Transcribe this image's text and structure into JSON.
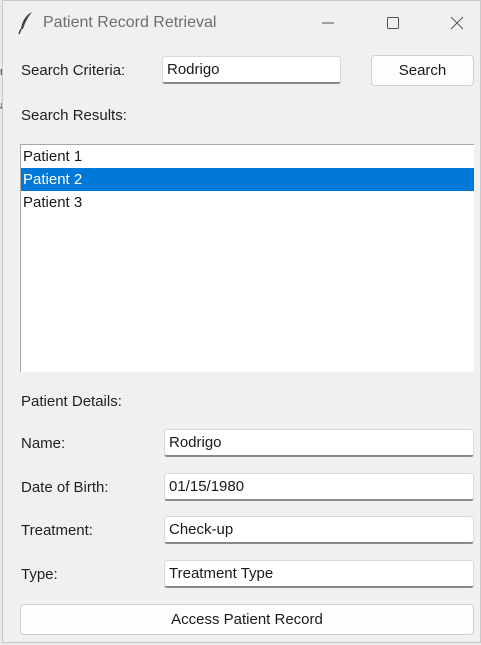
{
  "window": {
    "title": "Patient Record Retrieval"
  },
  "search": {
    "label": "Search Criteria:",
    "value": "Rodrigo",
    "button_label": "Search"
  },
  "results": {
    "label": "Search Results:",
    "items": [
      {
        "label": "Patient 1",
        "selected": false
      },
      {
        "label": "Patient 2",
        "selected": true
      },
      {
        "label": "Patient 3",
        "selected": false
      }
    ]
  },
  "details": {
    "heading": "Patient Details:",
    "name_label": "Name:",
    "name_value": "Rodrigo",
    "dob_label": "Date of Birth:",
    "dob_value": "01/15/1980",
    "treatment_label": "Treatment:",
    "treatment_value": "Check-up",
    "type_label": "Type:",
    "type_value": "Treatment Type"
  },
  "action": {
    "button_label": "Access Patient Record"
  },
  "colors": {
    "selection": "#0078d7",
    "window_bg": "#f0f0f0"
  }
}
